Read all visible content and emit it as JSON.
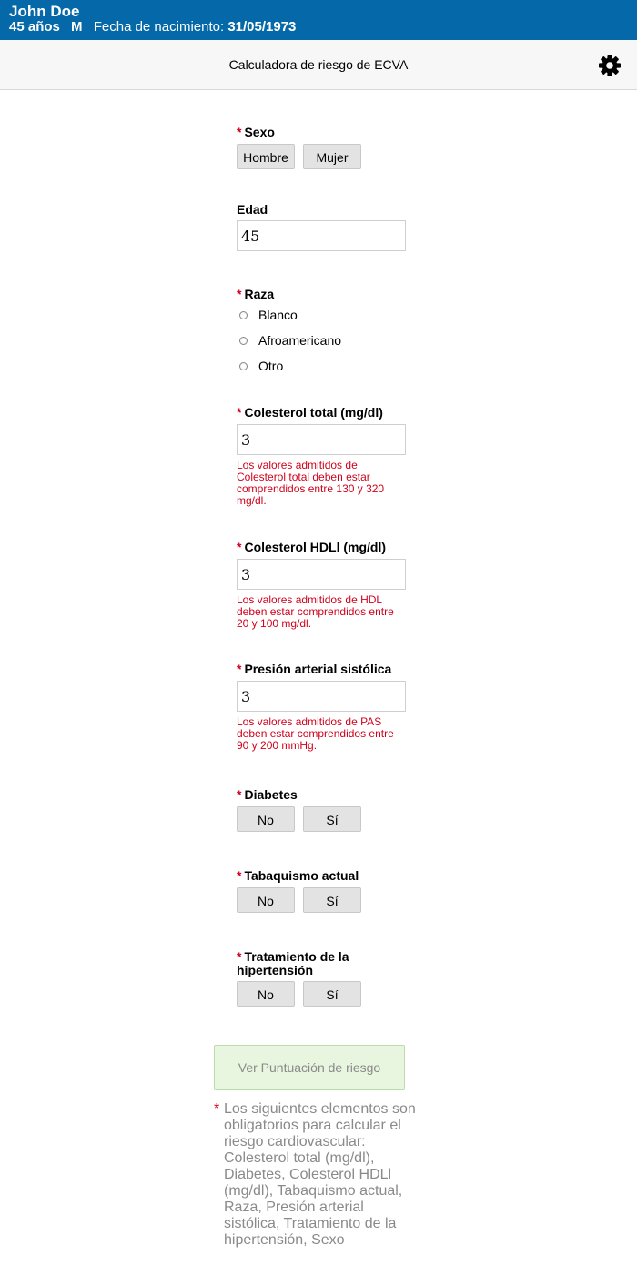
{
  "patient": {
    "name": "John Doe",
    "age": "45 años",
    "sex": "M",
    "dob_label": "Fecha de nacimiento:",
    "dob": "31/05/1973"
  },
  "header": {
    "title": "Calculadora de riesgo de ECVA",
    "settings_icon": "gear-icon"
  },
  "required_mark": "*",
  "form": {
    "sexo": {
      "label": "Sexo",
      "options": [
        "Hombre",
        "Mujer"
      ]
    },
    "edad": {
      "label": "Edad",
      "value": "45"
    },
    "raza": {
      "label": "Raza",
      "options": [
        "Blanco",
        "Afroamericano",
        "Otro"
      ]
    },
    "colesterol_total": {
      "label": "Colesterol total (mg/dl)",
      "value": "3",
      "error": "Los valores admitidos de Colesterol total deben estar comprendidos entre 130 y 320 mg/dl."
    },
    "colesterol_hdl": {
      "label": "Colesterol HDLl (mg/dl)",
      "value": "3",
      "error": "Los valores admitidos de HDL deben estar comprendidos entre 20 y 100 mg/dl."
    },
    "pas": {
      "label": "Presión arterial sistólica",
      "value": "3",
      "error": "Los valores admitidos de PAS deben estar comprendidos entre 90 y 200 mmHg."
    },
    "diabetes": {
      "label": "Diabetes",
      "options": [
        "No",
        "Sí"
      ]
    },
    "tabaquismo": {
      "label": "Tabaquismo actual",
      "options": [
        "No",
        "Sí"
      ]
    },
    "tratamiento": {
      "label": "Tratamiento de la hipertensión",
      "options": [
        "No",
        "Sí"
      ]
    }
  },
  "submit_label": "Ver Puntuación de riesgo",
  "footnote": "Los siguientes elementos son obligatorios para calcular el riesgo cardiovascular: Colesterol total (mg/dl), Diabetes, Colesterol HDLl (mg/dl), Tabaquismo actual, Raza, Presión arterial sistólica, Tratamiento de la hipertensión, Sexo",
  "colors": {
    "header_bg": "#0568a8",
    "required": "#d0021b",
    "error": "#d0021b",
    "submit_bg": "#e8f5df",
    "footnote_text": "#8a8a8a"
  }
}
